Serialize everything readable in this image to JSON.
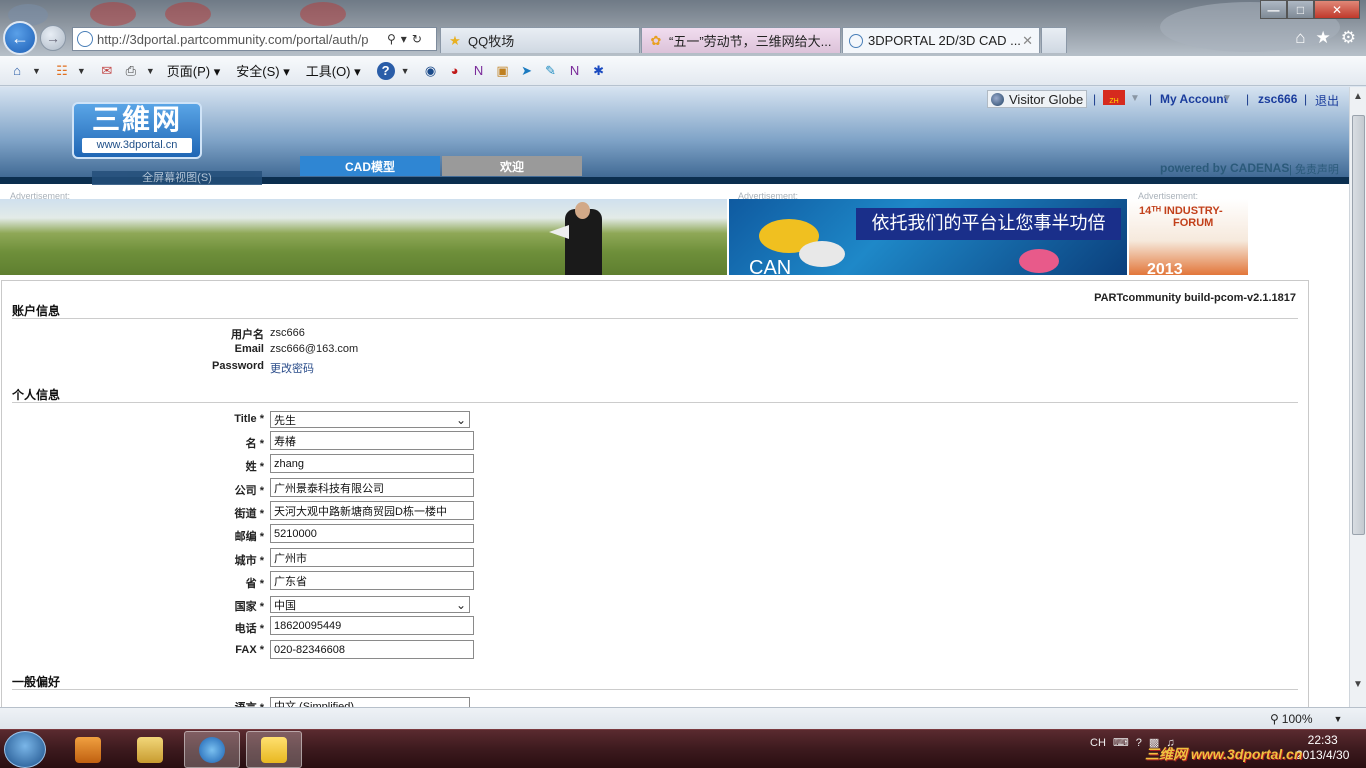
{
  "browser": {
    "address_url": "http://3dportal.partcommunity.com/portal/auth/p",
    "tabs": [
      {
        "label": "QQ牧场"
      },
      {
        "label": "“五一”劳动节，三维网给大..."
      },
      {
        "label": "3DPORTAL 2D/3D CAD ..."
      }
    ],
    "menus": {
      "page": "页面(P)",
      "safety": "安全(S)",
      "tools": "工具(O)"
    },
    "zoom": "100%"
  },
  "site": {
    "logo_main": "三維网",
    "logo_sub": "www.3dportal.cn",
    "visitor_globe": "Visitor Globe",
    "lang_flag": "ZH",
    "my_account": "My Account",
    "username_link": "zsc666",
    "logout": "退出",
    "nav_tabs": [
      {
        "label": "CAD模型",
        "active": true
      },
      {
        "label": "欢迎",
        "active": false
      }
    ],
    "powered_by": "powered by CADENAS",
    "disclaimer": "免责声明",
    "fullscreen": "全屏幕视图(S)",
    "ad_label": "Advertisement:",
    "ad2_text": "依托我们的平台让您事半功倍",
    "ad2_logo": "CAN",
    "ad3_line1": "14ᵀᴴ INDUSTRY-",
    "ad3_line2": "FORUM",
    "ad3_bottom": "2013"
  },
  "build_info": "PARTcommunity build-pcom-v2.1.1817",
  "account_section": {
    "title": "账户信息",
    "username_label": "用户名",
    "username_value": "zsc666",
    "email_label": "Email",
    "email_value": "zsc666@163.com",
    "password_label": "Password",
    "password_link": "更改密码"
  },
  "personal_section": {
    "title": "个人信息",
    "fields": {
      "title": {
        "label": "Title *",
        "value": "先生"
      },
      "first": {
        "label": "名 *",
        "value": "寿椿"
      },
      "last": {
        "label": "姓 *",
        "value": "zhang"
      },
      "company": {
        "label": "公司 *",
        "value": "广州景泰科技有限公司"
      },
      "street": {
        "label": "街道 *",
        "value": "天河大观中路新塘商贸园D栋一楼中"
      },
      "zip": {
        "label": "邮编 *",
        "value": "5210000"
      },
      "city": {
        "label": "城市 *",
        "value": "广州市"
      },
      "province": {
        "label": "省 *",
        "value": "广东省"
      },
      "country": {
        "label": "国家 *",
        "value": "中国"
      },
      "phone": {
        "label": "电话 *",
        "value": "18620095449"
      },
      "fax": {
        "label": "FAX *",
        "value": "020-82346608"
      }
    }
  },
  "general_section": {
    "title": "一般偏好",
    "language_label": "语言 *",
    "language_value": "中文 (Simplified)"
  },
  "taskbar": {
    "tray_lang": "CH",
    "clock_time": "22:33",
    "clock_date": "2013/4/30",
    "watermark": "三维网 www.3dportal.cn"
  }
}
